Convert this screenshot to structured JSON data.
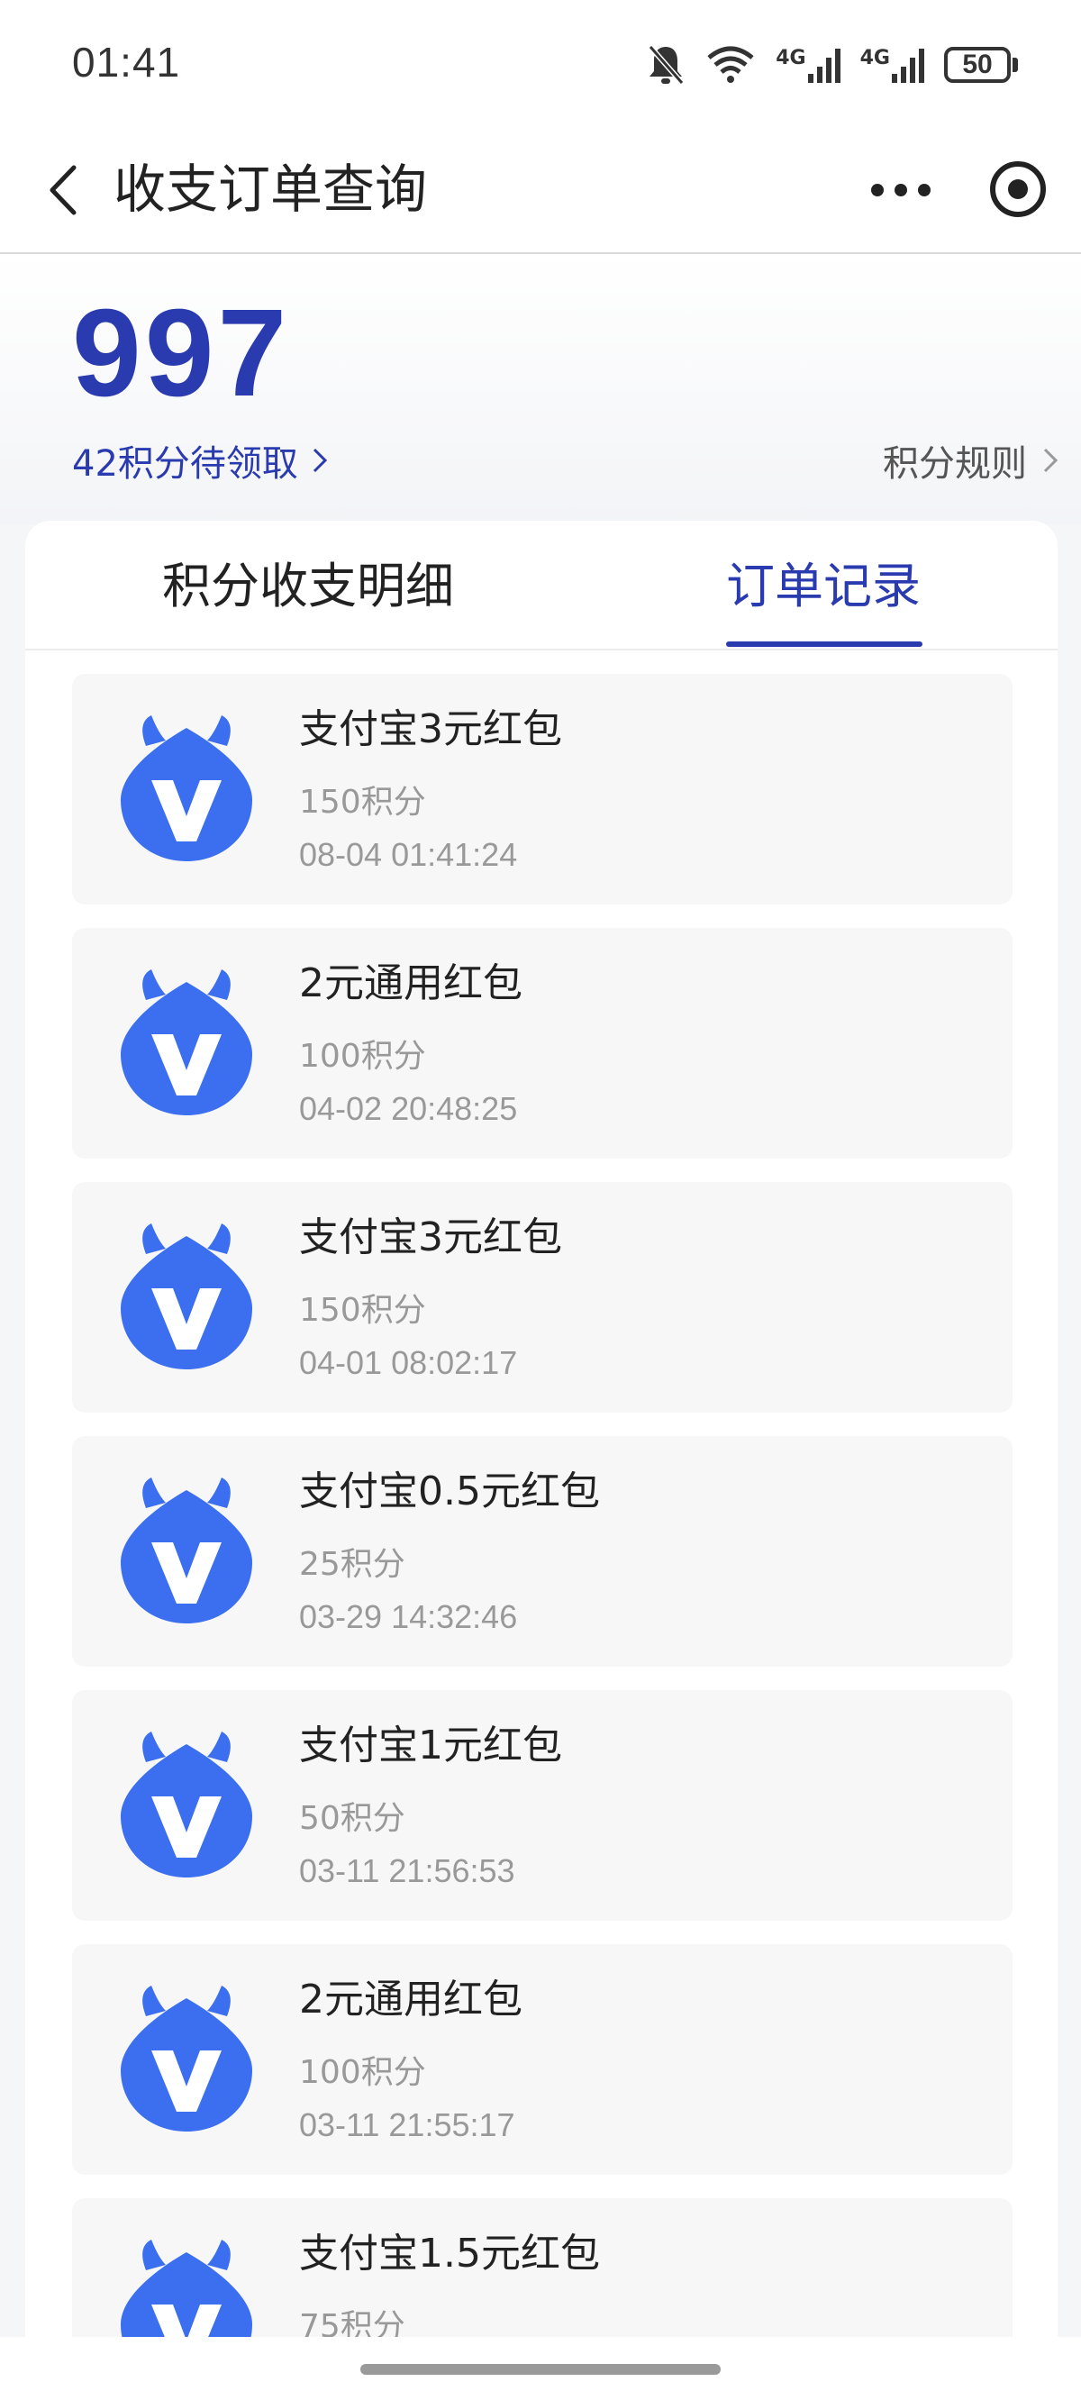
{
  "status_bar": {
    "time": "01:41",
    "battery": "50",
    "net1": "4G",
    "net2": "4G"
  },
  "nav": {
    "title": "收支订单查询"
  },
  "points": {
    "value": "997",
    "pending": "42积分待领取",
    "rules": "积分规则"
  },
  "tabs": {
    "points_detail": "积分收支明细",
    "order_records": "订单记录",
    "active": "order_records"
  },
  "theme": {
    "accent": "#2a3bb0",
    "logo_blue": "#3b6ff0"
  },
  "orders": [
    {
      "name": "支付宝3元红包",
      "points": "150积分",
      "time": "08-04 01:41:24"
    },
    {
      "name": "2元通用红包",
      "points": "100积分",
      "time": "04-02 20:48:25"
    },
    {
      "name": "支付宝3元红包",
      "points": "150积分",
      "time": "04-01 08:02:17"
    },
    {
      "name": "支付宝0.5元红包",
      "points": "25积分",
      "time": "03-29 14:32:46"
    },
    {
      "name": "支付宝1元红包",
      "points": "50积分",
      "time": "03-11 21:56:53"
    },
    {
      "name": "2元通用红包",
      "points": "100积分",
      "time": "03-11 21:55:17"
    },
    {
      "name": "支付宝1.5元红包",
      "points": "75积分",
      "time": ""
    }
  ]
}
